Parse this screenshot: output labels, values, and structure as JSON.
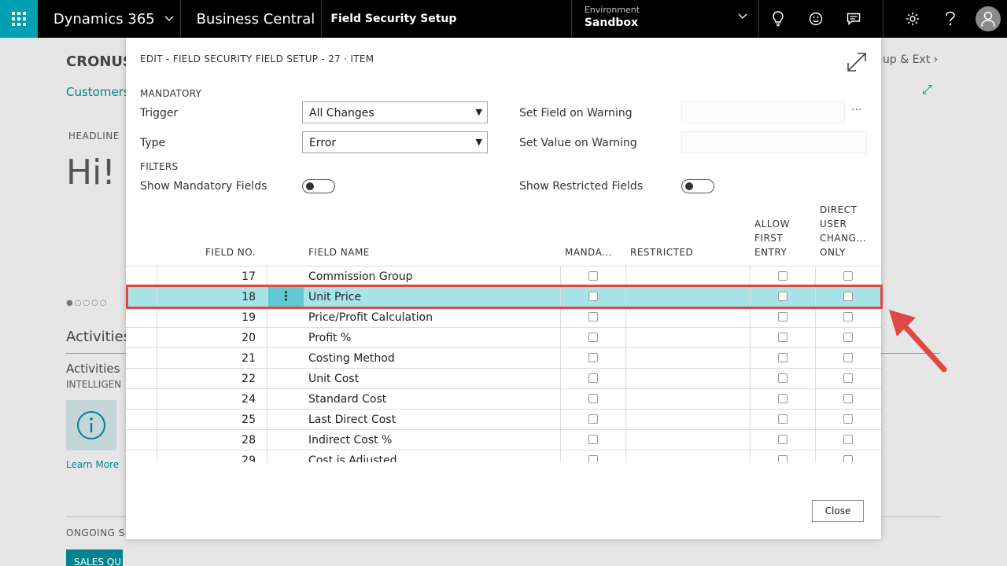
{
  "topbar": {
    "suite": "Dynamics 365",
    "product": "Business Central",
    "page": "Field Security Setup",
    "environment_label": "Environment",
    "environment_value": "Sandbox"
  },
  "background": {
    "title": "CRONUS",
    "link": "Customers",
    "headline": "HEADLINE",
    "greeting": "Hi!",
    "activities": "Activities",
    "activities2": "Activities",
    "intelligent": "INTELLIGEN",
    "learn_more": "Learn More",
    "ongoing": "ONGOING S",
    "sales": "SALES QU",
    "right_link": "up & Ext"
  },
  "dialog": {
    "title": "EDIT - FIELD SECURITY FIELD SETUP - 27 · ITEM",
    "mandatory_section": "MANDATORY",
    "trigger_label": "Trigger",
    "trigger_value": "All Changes",
    "type_label": "Type",
    "type_value": "Error",
    "set_field_label": "Set Field on Warning",
    "set_value_label": "Set Value on Warning",
    "filters_section": "FILTERS",
    "show_mandatory_label": "Show Mandatory Fields",
    "show_restricted_label": "Show Restricted Fields",
    "close_label": "Close"
  },
  "grid": {
    "headers": {
      "field_no": "FIELD NO.",
      "field_name": "FIELD NAME",
      "mandatory": "MANDA...",
      "restricted": "RESTRICTED",
      "allow_first_1": "ALLOW",
      "allow_first_2": "FIRST",
      "allow_first_3": "ENTRY",
      "direct_1": "DIRECT",
      "direct_2": "USER",
      "direct_3": "CHANG...",
      "direct_4": "ONLY"
    },
    "rows": [
      {
        "no": "17",
        "name": "Commission Group"
      },
      {
        "no": "18",
        "name": "Unit Price"
      },
      {
        "no": "19",
        "name": "Price/Profit Calculation"
      },
      {
        "no": "20",
        "name": "Profit %"
      },
      {
        "no": "21",
        "name": "Costing Method"
      },
      {
        "no": "22",
        "name": "Unit Cost"
      },
      {
        "no": "24",
        "name": "Standard Cost"
      },
      {
        "no": "25",
        "name": "Last Direct Cost"
      },
      {
        "no": "28",
        "name": "Indirect Cost %"
      },
      {
        "no": "29",
        "name": "Cost is Adjusted"
      }
    ],
    "selected_index": 1
  },
  "colors": {
    "accent": "#00a0b4",
    "selected_row": "#a8e3e8",
    "annotation": "#e04848"
  }
}
